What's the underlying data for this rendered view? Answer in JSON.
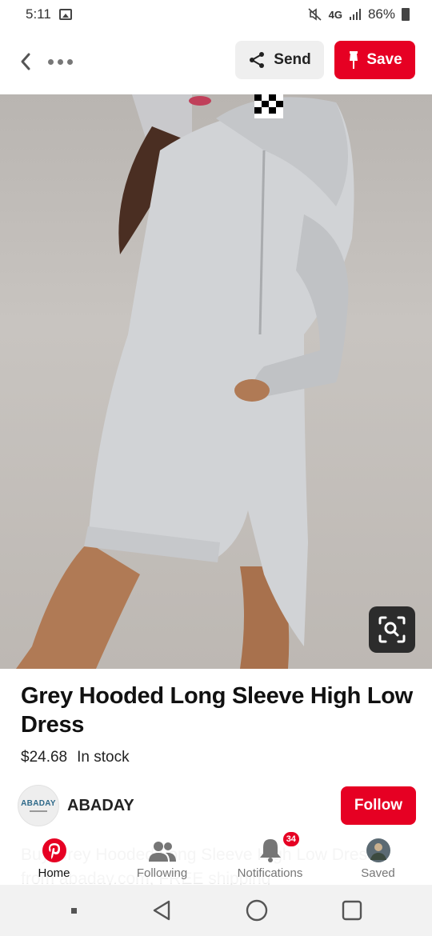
{
  "status_bar": {
    "time": "5:11",
    "network": "4G",
    "battery": "86%"
  },
  "top_bar": {
    "send_label": "Send",
    "save_label": "Save"
  },
  "product": {
    "title": "Grey Hooded Long Sleeve High Low Dress",
    "price": "$24.68",
    "stock": "In stock"
  },
  "seller": {
    "avatar_text": "ABADAY",
    "name": "ABADAY",
    "follow_label": "Follow"
  },
  "description_faded": "Buy Grey Hooded Long Sleeve High Low Dress from abaday.com, FREE shipping",
  "bottom_nav": {
    "items": [
      {
        "label": "Home",
        "icon": "pinterest-logo-icon",
        "active": true
      },
      {
        "label": "Following",
        "icon": "people-icon"
      },
      {
        "label": "Notifications",
        "icon": "bell-icon",
        "badge": "34"
      },
      {
        "label": "Saved",
        "icon": "profile-avatar"
      }
    ]
  },
  "colors": {
    "brand_red": "#e60023",
    "send_bg": "#efefef"
  }
}
